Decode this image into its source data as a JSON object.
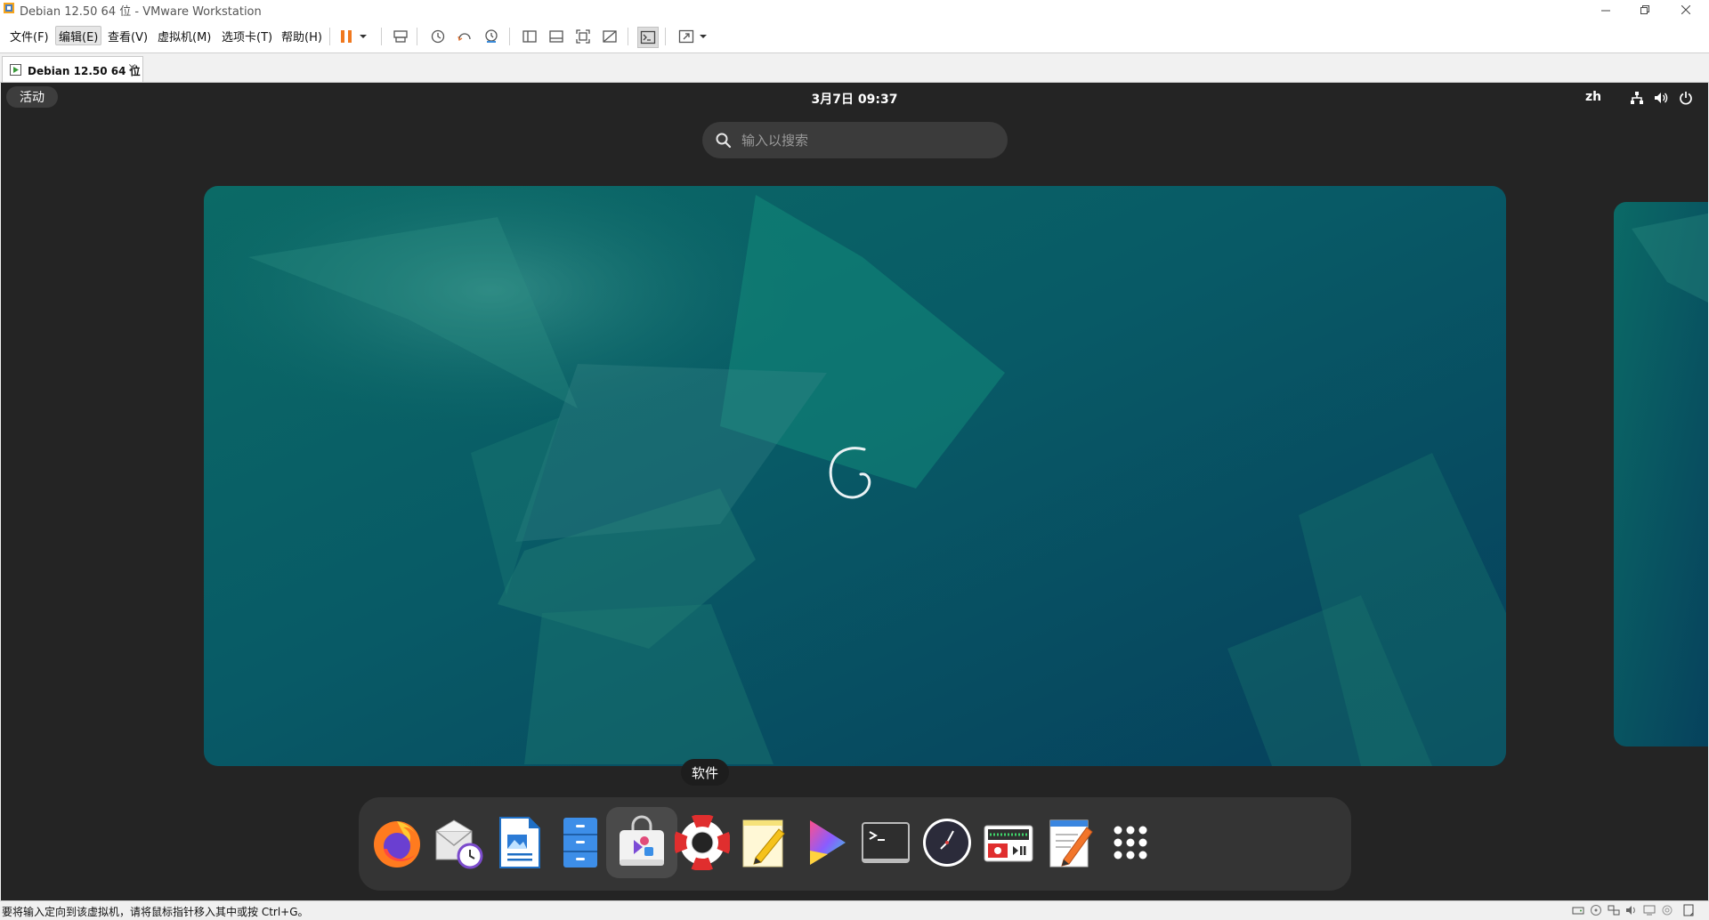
{
  "window": {
    "title": "Debian 12.50 64 位 - VMware Workstation"
  },
  "menu": {
    "items": [
      "文件(F)",
      "编辑(E)",
      "查看(V)",
      "虚拟机(M)",
      "选项卡(T)",
      "帮助(H)"
    ],
    "active_index": 1
  },
  "tab": {
    "label": "Debian 12.50 64 位",
    "close": "×"
  },
  "guest": {
    "activities": "活动",
    "clock": "3月7日  09:37",
    "language": "zh",
    "search_placeholder": "输入以搜索",
    "tooltip": "软件",
    "dock_items": [
      {
        "name": "Firefox",
        "icon": "firefox-icon"
      },
      {
        "name": "Evolution",
        "icon": "mail-clock-icon"
      },
      {
        "name": "LibreOffice Writer",
        "icon": "writer-icon"
      },
      {
        "name": "Files",
        "icon": "files-icon"
      },
      {
        "name": "Software",
        "icon": "software-icon",
        "highlighted": true
      },
      {
        "name": "Help",
        "icon": "help-lifebuoy-icon"
      },
      {
        "name": "Notes",
        "icon": "notes-icon"
      },
      {
        "name": "Videos",
        "icon": "videos-icon"
      },
      {
        "name": "Terminal",
        "icon": "terminal-icon"
      },
      {
        "name": "Clocks",
        "icon": "clock-icon"
      },
      {
        "name": "Sound Recorder",
        "icon": "recorder-icon"
      },
      {
        "name": "Text Editor",
        "icon": "text-editor-icon"
      },
      {
        "name": "Show Applications",
        "icon": "app-grid-icon"
      }
    ],
    "wallpaper_colors": {
      "teal": "#0a5f63",
      "dark": "#07425e",
      "green": "#12907a"
    }
  },
  "statusbar": {
    "message": "要将输入定向到该虚拟机，请将鼠标指针移入其中或按 Ctrl+G。"
  },
  "colors": {
    "pause_accent": "#f0781e"
  }
}
